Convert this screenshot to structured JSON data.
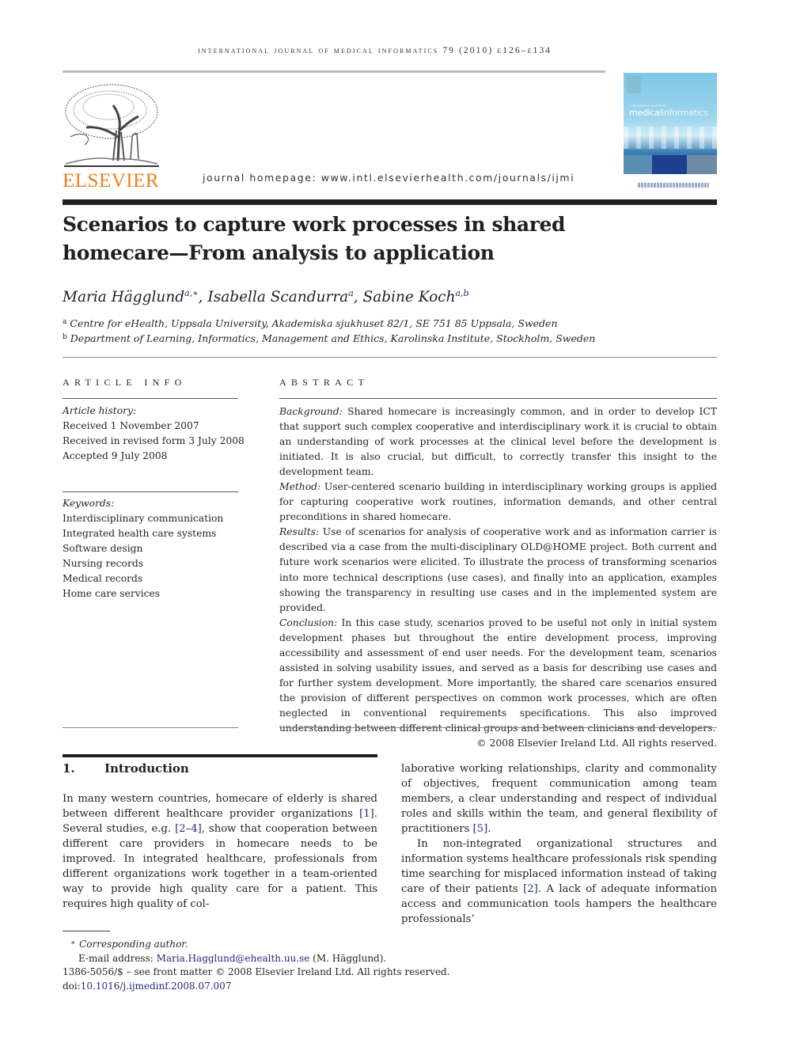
{
  "header": {
    "running_head": "International Journal of Medical Informatics 79 (2010) e126–e134",
    "publisher_logo_text": "ELSEVIER",
    "homepage": "journal homepage: www.intl.elsevierhealth.com/journals/ijmi",
    "cover": {
      "small_title": "international journal of",
      "title_part1": "medical",
      "title_part2": "informatics"
    },
    "colors": {
      "elsevier_orange": "#f07f1a",
      "link_blue": "#1f2a7a"
    }
  },
  "article": {
    "title_line1": "Scenarios to capture work processes in shared",
    "title_line2": "homecare—From analysis to application",
    "authors": [
      {
        "name": "Maria Hägglund",
        "sup": "a,∗"
      },
      {
        "name": "Isabella Scandurra",
        "sup": "a"
      },
      {
        "name": "Sabine Koch",
        "sup": "a,b"
      }
    ],
    "affiliations": [
      {
        "mark": "a",
        "text": "Centre for eHealth, Uppsala University, Akademiska sjukhuset 82/1, SE 751 85 Uppsala, Sweden"
      },
      {
        "mark": "b",
        "text": "Department of Learning, Informatics, Management and Ethics, Karolinska Institute, Stockholm, Sweden"
      }
    ]
  },
  "article_info": {
    "heading": "article info",
    "history_label": "Article history:",
    "history": [
      "Received 1 November 2007",
      "Received in revised form 3 July 2008",
      "Accepted 9 July 2008"
    ],
    "keywords_label": "Keywords:",
    "keywords": [
      "Interdisciplinary communication",
      "Integrated health care systems",
      "Software design",
      "Nursing records",
      "Medical records",
      "Home care services"
    ]
  },
  "abstract": {
    "heading": "abstract",
    "sections": [
      {
        "label": "Background:",
        "text": " Shared homecare is increasingly common, and in order to develop ICT that support such complex cooperative and interdisciplinary work it is crucial to obtain an understanding of work processes at the clinical level before the development is initiated. It is also crucial, but difficult, to correctly transfer this insight to the development team."
      },
      {
        "label": "Method:",
        "text": " User-centered scenario building in interdisciplinary working groups is applied for capturing cooperative work routines, information demands, and other central preconditions in shared homecare."
      },
      {
        "label": "Results:",
        "text": " Use of scenarios for analysis of cooperative work and as information carrier is described via a case from the multi-disciplinary OLD@HOME project. Both current and future work scenarios were elicited. To illustrate the process of transforming scenarios into more technical descriptions (use cases), and finally into an application, examples showing the transparency in resulting use cases and in the implemented system are provided."
      },
      {
        "label": "Conclusion:",
        "text": " In this case study, scenarios proved to be useful not only in initial system development phases but throughout the entire development process, improving accessibility and assessment of end user needs. For the development team, scenarios assisted in solving usability issues, and served as a basis for describing use cases and for further system development. More importantly, the shared care scenarios ensured the provision of different perspectives on common work processes, which are often neglected in conventional requirements specifications. This also improved understanding between different clinical groups and between clinicians and developers."
      }
    ],
    "copyright": "© 2008 Elsevier Ireland Ltd. All rights reserved."
  },
  "introduction": {
    "number": "1.",
    "title": "Introduction",
    "col1": {
      "t1": "In many western countries, homecare of elderly is shared between different healthcare provider organizations ",
      "r1": "[1]",
      "t2": ". Several studies, e.g. ",
      "r2": "[2–4]",
      "t3": ", show that cooperation between different care providers in homecare needs to be improved. In integrated healthcare, professionals from different organizations work together in a team-oriented way to provide high quality care for a patient. This requires high quality of col-"
    },
    "col2": {
      "t1": "laborative working relationships, clarity and commonality of objectives, frequent communication among team members, a clear understanding and respect of individual roles and skills within the team, and general flexibility of practitioners ",
      "r1": "[5]",
      "t2": ".",
      "p2_t1": "In non-integrated organizational structures and information systems healthcare professionals risk spending time searching for misplaced information instead of taking care of their patients ",
      "p2_r1": "[2]",
      "p2_t2": ". A lack of adequate information access and communication tools hampers the healthcare professionals’"
    }
  },
  "footnotes": {
    "corresponding_mark": "∗",
    "corresponding": "Corresponding author.",
    "email_label": "E-mail address: ",
    "email": "Maria.Hagglund@ehealth.uu.se",
    "email_suffix": " (M. Hägglund).",
    "front_matter": "1386-5056/$ – see front matter © 2008 Elsevier Ireland Ltd. All rights reserved.",
    "doi_label": "doi:",
    "doi": "10.1016/j.ijmedinf.2008.07.007"
  }
}
